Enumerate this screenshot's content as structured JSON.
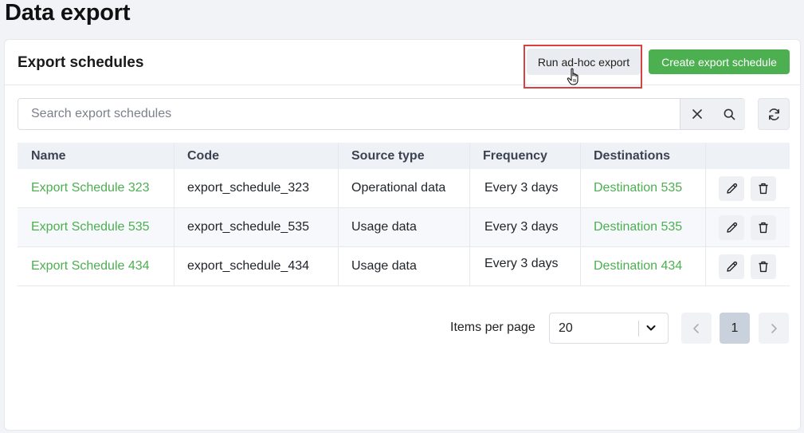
{
  "page": {
    "title": "Data export"
  },
  "card": {
    "title": "Export schedules",
    "adhoc_label": "Run ad-hoc export",
    "create_label": "Create export schedule"
  },
  "search": {
    "placeholder": "Search export schedules",
    "value": ""
  },
  "table": {
    "headers": [
      "Name",
      "Code",
      "Source type",
      "Frequency",
      "Destinations"
    ],
    "rows": [
      {
        "name": "Export Schedule 323",
        "code": "export_schedule_323",
        "source": "Operational data",
        "frequency": "Every 3 days",
        "destination": "Destination 535"
      },
      {
        "name": "Export Schedule 535",
        "code": "export_schedule_535",
        "source": "Usage data",
        "frequency": "Every 3 days",
        "destination": "Destination 535"
      },
      {
        "name": "Export Schedule 434",
        "code": "export_schedule_434",
        "source": "Usage data",
        "frequency": "Every 3 days",
        "destination": "Destination 434"
      }
    ]
  },
  "pagination": {
    "items_per_page_label": "Items per page",
    "items_per_page_value": "20",
    "current_page": "1"
  },
  "colors": {
    "accent": "#4caf50",
    "highlight": "#d94040"
  },
  "icons": [
    "clear-icon",
    "search-icon",
    "refresh-icon",
    "edit-icon",
    "trash-icon",
    "chevron-down-icon",
    "chevron-left-icon",
    "chevron-right-icon",
    "hand-cursor-icon"
  ]
}
